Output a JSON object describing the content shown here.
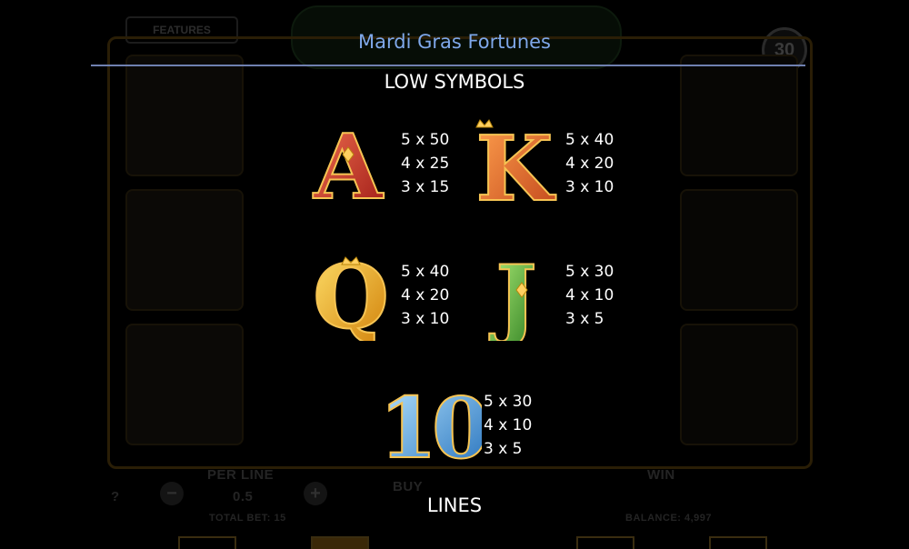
{
  "header": {
    "title": "Mardi Gras Fortunes"
  },
  "sections": {
    "low_symbols": "LOW SYMBOLS",
    "lines": "LINES"
  },
  "symbols": [
    {
      "name": "A",
      "colors": [
        "#e8503a",
        "#a41e1a"
      ],
      "pays": [
        "5 x 50",
        "4 x 25",
        "3 x 15"
      ]
    },
    {
      "name": "K",
      "colors": [
        "#f58a3c",
        "#c4461a"
      ],
      "pays": [
        "5 x 40",
        "4 x 20",
        "3 x 10"
      ]
    },
    {
      "name": "Q",
      "colors": [
        "#ffd54a",
        "#d88d0c"
      ],
      "pays": [
        "5 x 40",
        "4 x 20",
        "3 x 10"
      ]
    },
    {
      "name": "J",
      "colors": [
        "#9be35e",
        "#3e8f2a"
      ],
      "pays": [
        "5 x 30",
        "4 x 10",
        "3 x 5"
      ]
    },
    {
      "name": "10",
      "colors": [
        "#9bd8f6",
        "#2a78c4"
      ],
      "pays": [
        "5 x 30",
        "4 x 10",
        "3 x 5"
      ]
    }
  ],
  "background": {
    "features_label": "FEATURES",
    "lines_count": "30",
    "per_line_label": "PER LINE",
    "per_line_value": "0.5",
    "buy_label": "BUY",
    "win_label": "WIN",
    "total_bet": "TOTAL BET: 15",
    "balance": "BALANCE: 4,997",
    "help": "?"
  }
}
